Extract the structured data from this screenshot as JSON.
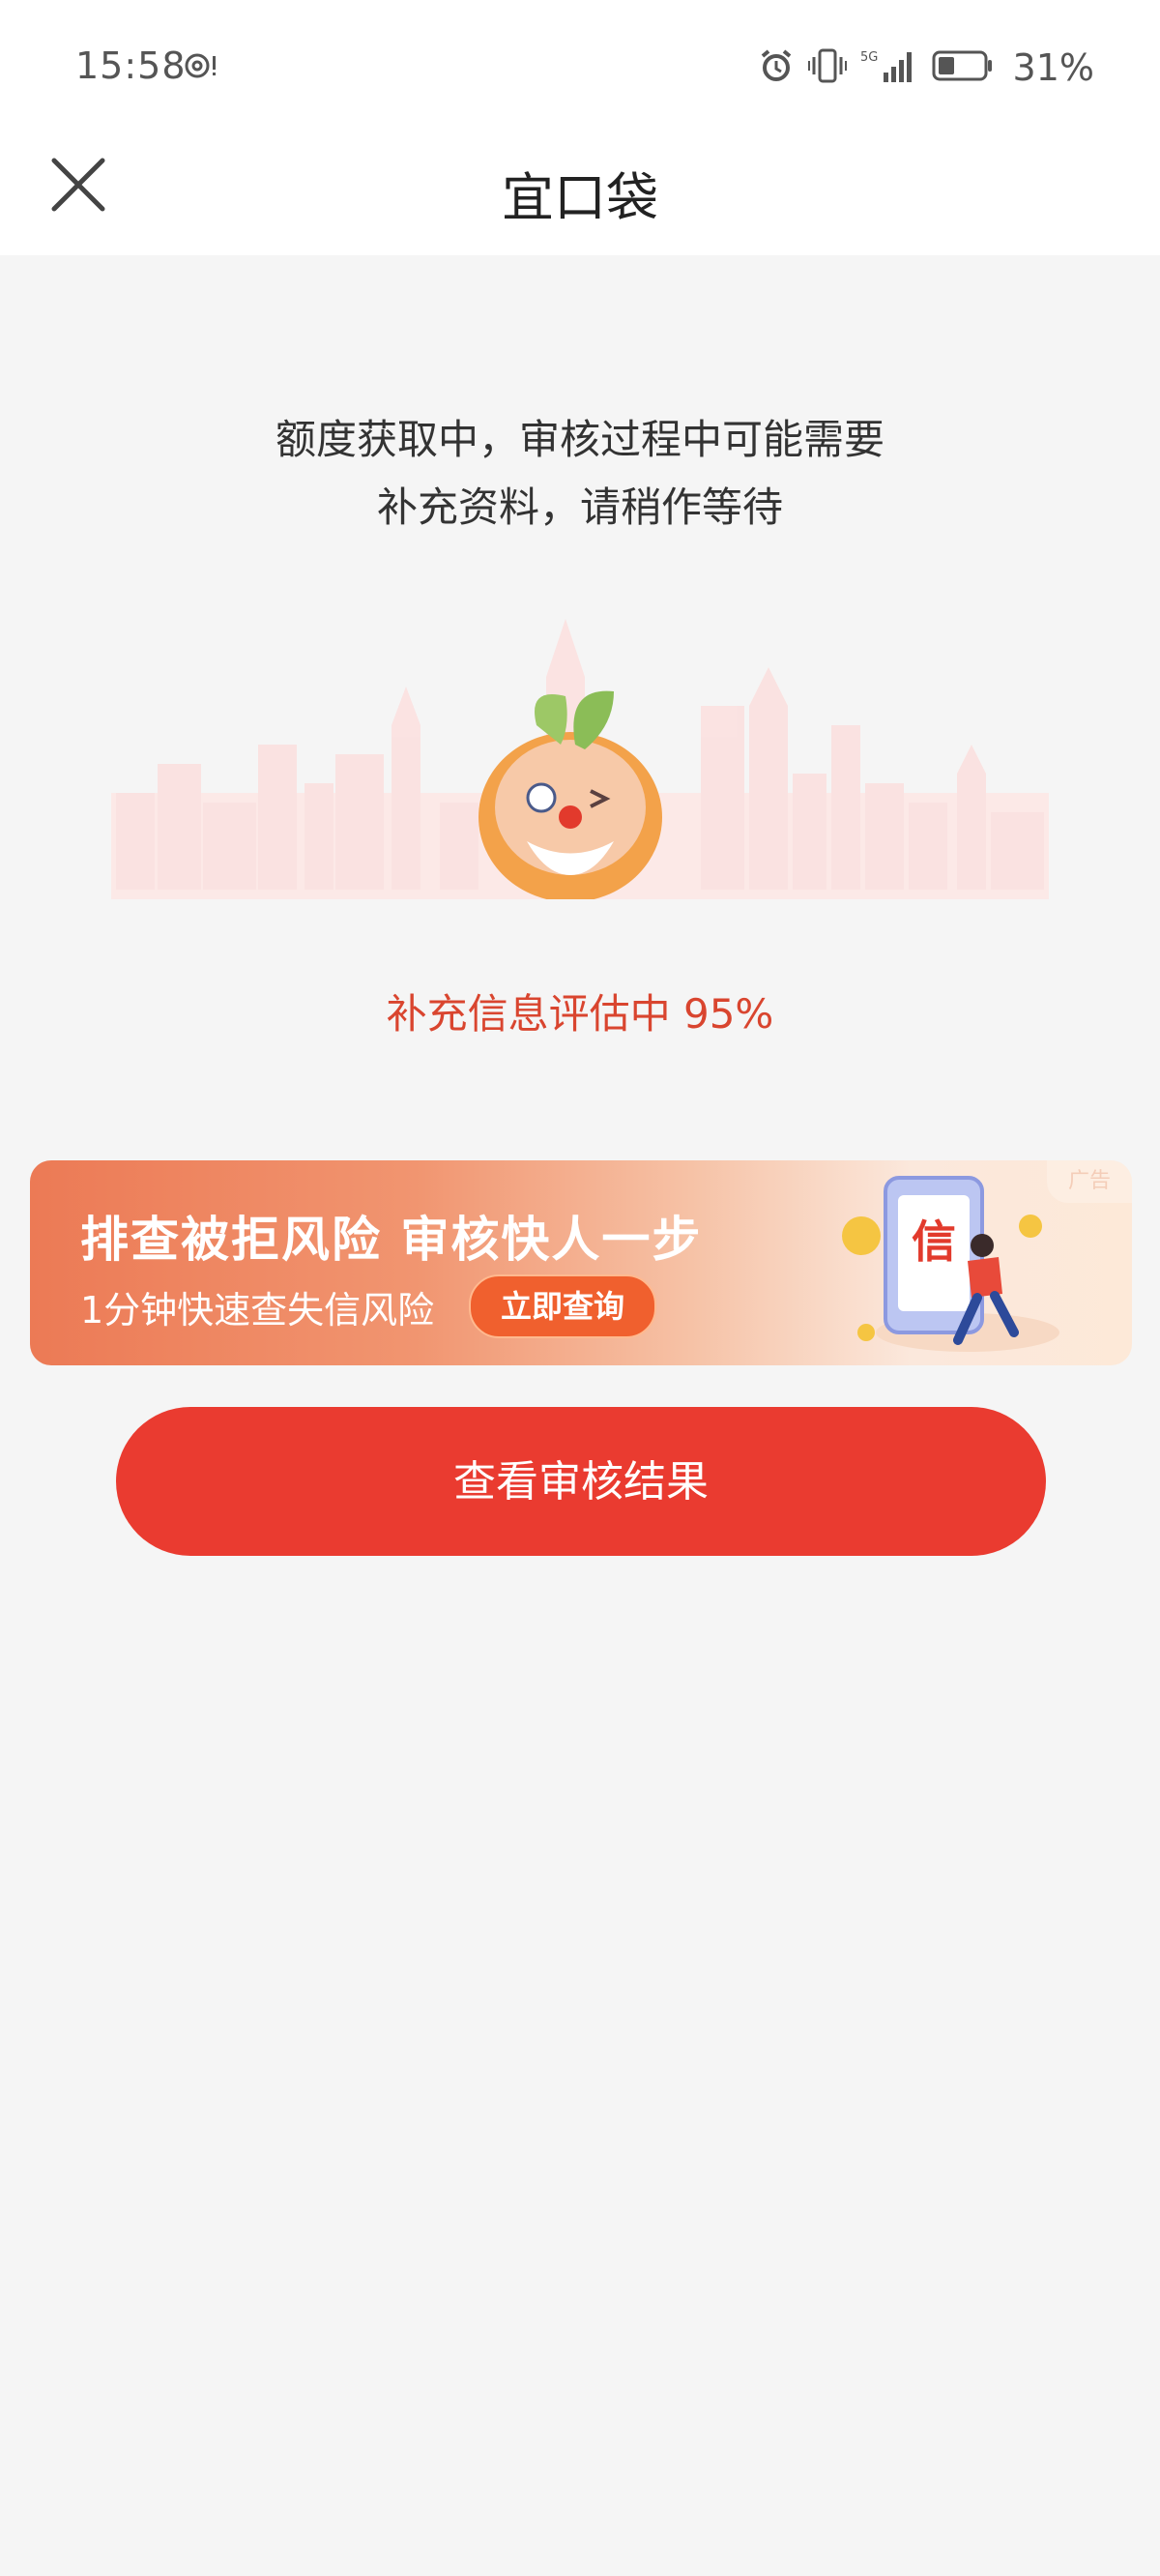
{
  "status_bar": {
    "time": "15:58",
    "battery": "31%",
    "network": "5G"
  },
  "header": {
    "title": "宜口袋"
  },
  "main": {
    "intro_line1": "额度获取中，审核过程中可能需要",
    "intro_line2": "补充资料，请稍作等待",
    "progress_label": "补充信息评估中 95%",
    "progress_percent": 95
  },
  "ad": {
    "title": "排查被拒风险  审核快人一步",
    "subtitle": "1分钟快速查失信风险",
    "cta": "立即查询",
    "tag": "广告",
    "art_text": "信"
  },
  "actions": {
    "view_result": "查看审核结果"
  },
  "colors": {
    "accent": "#ea3b30",
    "progress_text": "#d9452f"
  }
}
